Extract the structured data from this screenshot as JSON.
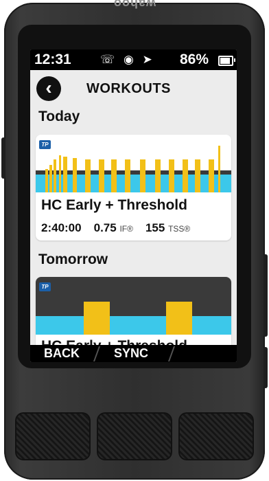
{
  "device": {
    "brand": "wahoo"
  },
  "status_bar": {
    "time": "12:31",
    "icons": "☏ ◉ ➤",
    "battery_pct": "86%",
    "battery_level": 0.86
  },
  "header": {
    "back_symbol": "‹",
    "title": "WORKOUTS"
  },
  "sections": [
    {
      "label": "Today",
      "workout": {
        "badge": "TP",
        "name": "HC Early + Threshold",
        "duration": "2:40:00",
        "if_value": "0.75",
        "if_unit": "IF®",
        "tss_value": "155",
        "tss_unit": "TSS®"
      }
    },
    {
      "label": "Tomorrow",
      "workout": {
        "badge": "TP",
        "name": "HC Early + Threshold"
      }
    }
  ],
  "footer": {
    "back_label": "BACK",
    "sync_label": "SYNC"
  },
  "colors": {
    "zone_yellow": "#f2c018",
    "zone_blue": "#3cc8ea",
    "chart_bg": "#3a3a3a",
    "tp_blue": "#1b5fa8"
  }
}
